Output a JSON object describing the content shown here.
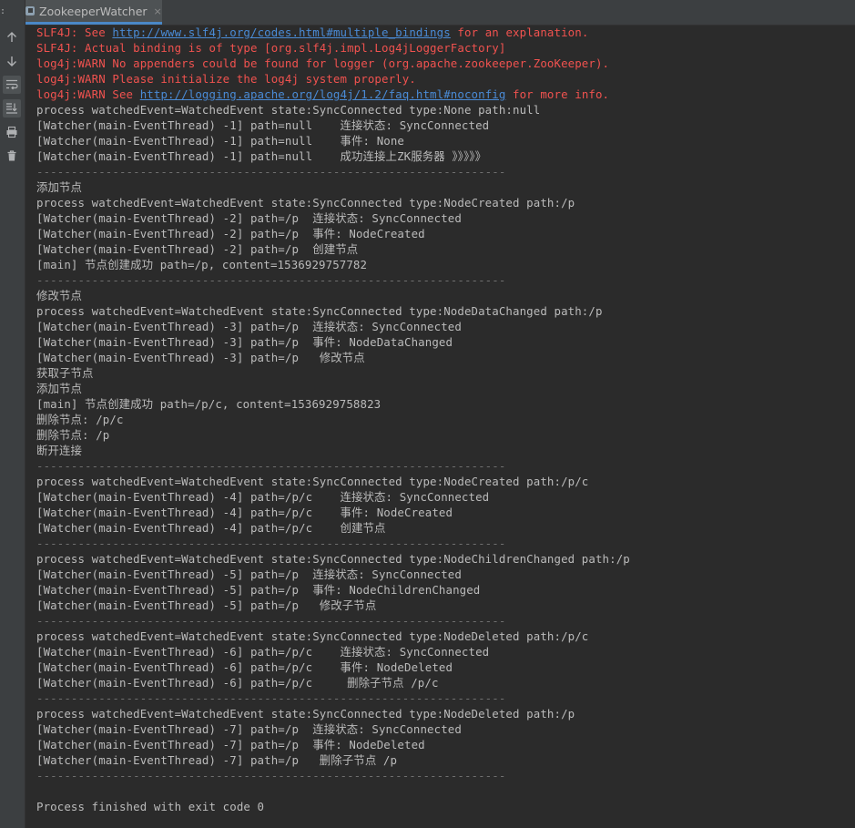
{
  "tab": {
    "title": "ZookeeperWatcher",
    "close": "×"
  },
  "toolbar": {
    "icons": [
      "arrow-up-icon",
      "arrow-down-icon",
      "soft-wrap-icon",
      "scroll-to-end-icon",
      "print-icon",
      "trash-icon"
    ]
  },
  "colors": {
    "error": "#f0524f",
    "link": "#4a8bd6",
    "text": "#bbbbbb",
    "background": "#2b2b2b"
  },
  "console": {
    "lines": [
      {
        "type": "err",
        "parts": [
          {
            "t": "SLF4J: See "
          },
          {
            "t": "http://www.slf4j.org/codes.html#multiple_bindings",
            "link": true
          },
          {
            "t": " for an explanation."
          }
        ]
      },
      {
        "type": "err",
        "parts": [
          {
            "t": "SLF4J: Actual binding is of type [org.slf4j.impl.Log4jLoggerFactory]"
          }
        ]
      },
      {
        "type": "err",
        "parts": [
          {
            "t": "log4j:WARN No appenders could be found for logger (org.apache.zookeeper.ZooKeeper)."
          }
        ]
      },
      {
        "type": "err",
        "parts": [
          {
            "t": "log4j:WARN Please initialize the log4j system properly."
          }
        ]
      },
      {
        "type": "err",
        "parts": [
          {
            "t": "log4j:WARN See "
          },
          {
            "t": "http://logging.apache.org/log4j/1.2/faq.html#noconfig",
            "link": true
          },
          {
            "t": " for more info."
          }
        ]
      },
      {
        "type": "ok",
        "parts": [
          {
            "t": "process watchedEvent=WatchedEvent state:SyncConnected type:None path:null"
          }
        ]
      },
      {
        "type": "ok",
        "parts": [
          {
            "t": "[Watcher(main-EventThread) -1] path=null    连接状态: SyncConnected"
          }
        ]
      },
      {
        "type": "ok",
        "parts": [
          {
            "t": "[Watcher(main-EventThread) -1] path=null    事件: None"
          }
        ]
      },
      {
        "type": "ok",
        "parts": [
          {
            "t": "[Watcher(main-EventThread) -1] path=null    成功连接上ZK服务器 》》》》》"
          }
        ]
      },
      {
        "type": "sep",
        "parts": [
          {
            "t": "--------------------------------------------------------------------"
          }
        ]
      },
      {
        "type": "ok",
        "parts": [
          {
            "t": "添加节点"
          }
        ]
      },
      {
        "type": "ok",
        "parts": [
          {
            "t": "process watchedEvent=WatchedEvent state:SyncConnected type:NodeCreated path:/p"
          }
        ]
      },
      {
        "type": "ok",
        "parts": [
          {
            "t": "[Watcher(main-EventThread) -2] path=/p  连接状态: SyncConnected"
          }
        ]
      },
      {
        "type": "ok",
        "parts": [
          {
            "t": "[Watcher(main-EventThread) -2] path=/p  事件: NodeCreated"
          }
        ]
      },
      {
        "type": "ok",
        "parts": [
          {
            "t": "[Watcher(main-EventThread) -2] path=/p  创建节点"
          }
        ]
      },
      {
        "type": "ok",
        "parts": [
          {
            "t": "[main] 节点创建成功 path=/p, content=1536929757782"
          }
        ]
      },
      {
        "type": "sep",
        "parts": [
          {
            "t": "--------------------------------------------------------------------"
          }
        ]
      },
      {
        "type": "ok",
        "parts": [
          {
            "t": "修改节点"
          }
        ]
      },
      {
        "type": "ok",
        "parts": [
          {
            "t": "process watchedEvent=WatchedEvent state:SyncConnected type:NodeDataChanged path:/p"
          }
        ]
      },
      {
        "type": "ok",
        "parts": [
          {
            "t": "[Watcher(main-EventThread) -3] path=/p  连接状态: SyncConnected"
          }
        ]
      },
      {
        "type": "ok",
        "parts": [
          {
            "t": "[Watcher(main-EventThread) -3] path=/p  事件: NodeDataChanged"
          }
        ]
      },
      {
        "type": "ok",
        "parts": [
          {
            "t": "[Watcher(main-EventThread) -3] path=/p   修改节点"
          }
        ]
      },
      {
        "type": "ok",
        "parts": [
          {
            "t": "获取子节点"
          }
        ]
      },
      {
        "type": "ok",
        "parts": [
          {
            "t": "添加节点"
          }
        ]
      },
      {
        "type": "ok",
        "parts": [
          {
            "t": "[main] 节点创建成功 path=/p/c, content=1536929758823"
          }
        ]
      },
      {
        "type": "ok",
        "parts": [
          {
            "t": "删除节点: /p/c"
          }
        ]
      },
      {
        "type": "ok",
        "parts": [
          {
            "t": "删除节点: /p"
          }
        ]
      },
      {
        "type": "ok",
        "parts": [
          {
            "t": "断开连接"
          }
        ]
      },
      {
        "type": "sep",
        "parts": [
          {
            "t": "--------------------------------------------------------------------"
          }
        ]
      },
      {
        "type": "ok",
        "parts": [
          {
            "t": "process watchedEvent=WatchedEvent state:SyncConnected type:NodeCreated path:/p/c"
          }
        ]
      },
      {
        "type": "ok",
        "parts": [
          {
            "t": "[Watcher(main-EventThread) -4] path=/p/c    连接状态: SyncConnected"
          }
        ]
      },
      {
        "type": "ok",
        "parts": [
          {
            "t": "[Watcher(main-EventThread) -4] path=/p/c    事件: NodeCreated"
          }
        ]
      },
      {
        "type": "ok",
        "parts": [
          {
            "t": "[Watcher(main-EventThread) -4] path=/p/c    创建节点"
          }
        ]
      },
      {
        "type": "sep",
        "parts": [
          {
            "t": "--------------------------------------------------------------------"
          }
        ]
      },
      {
        "type": "ok",
        "parts": [
          {
            "t": "process watchedEvent=WatchedEvent state:SyncConnected type:NodeChildrenChanged path:/p"
          }
        ]
      },
      {
        "type": "ok",
        "parts": [
          {
            "t": "[Watcher(main-EventThread) -5] path=/p  连接状态: SyncConnected"
          }
        ]
      },
      {
        "type": "ok",
        "parts": [
          {
            "t": "[Watcher(main-EventThread) -5] path=/p  事件: NodeChildrenChanged"
          }
        ]
      },
      {
        "type": "ok",
        "parts": [
          {
            "t": "[Watcher(main-EventThread) -5] path=/p   修改子节点"
          }
        ]
      },
      {
        "type": "sep",
        "parts": [
          {
            "t": "--------------------------------------------------------------------"
          }
        ]
      },
      {
        "type": "ok",
        "parts": [
          {
            "t": "process watchedEvent=WatchedEvent state:SyncConnected type:NodeDeleted path:/p/c"
          }
        ]
      },
      {
        "type": "ok",
        "parts": [
          {
            "t": "[Watcher(main-EventThread) -6] path=/p/c    连接状态: SyncConnected"
          }
        ]
      },
      {
        "type": "ok",
        "parts": [
          {
            "t": "[Watcher(main-EventThread) -6] path=/p/c    事件: NodeDeleted"
          }
        ]
      },
      {
        "type": "ok",
        "parts": [
          {
            "t": "[Watcher(main-EventThread) -6] path=/p/c     删除子节点 /p/c"
          }
        ]
      },
      {
        "type": "sep",
        "parts": [
          {
            "t": "--------------------------------------------------------------------"
          }
        ]
      },
      {
        "type": "ok",
        "parts": [
          {
            "t": "process watchedEvent=WatchedEvent state:SyncConnected type:NodeDeleted path:/p"
          }
        ]
      },
      {
        "type": "ok",
        "parts": [
          {
            "t": "[Watcher(main-EventThread) -7] path=/p  连接状态: SyncConnected"
          }
        ]
      },
      {
        "type": "ok",
        "parts": [
          {
            "t": "[Watcher(main-EventThread) -7] path=/p  事件: NodeDeleted"
          }
        ]
      },
      {
        "type": "ok",
        "parts": [
          {
            "t": "[Watcher(main-EventThread) -7] path=/p   删除子节点 /p"
          }
        ]
      },
      {
        "type": "sep",
        "parts": [
          {
            "t": "--------------------------------------------------------------------"
          }
        ]
      },
      {
        "type": "ok",
        "parts": [
          {
            "t": ""
          }
        ]
      },
      {
        "type": "ok",
        "parts": [
          {
            "t": "Process finished with exit code 0"
          }
        ]
      }
    ]
  }
}
